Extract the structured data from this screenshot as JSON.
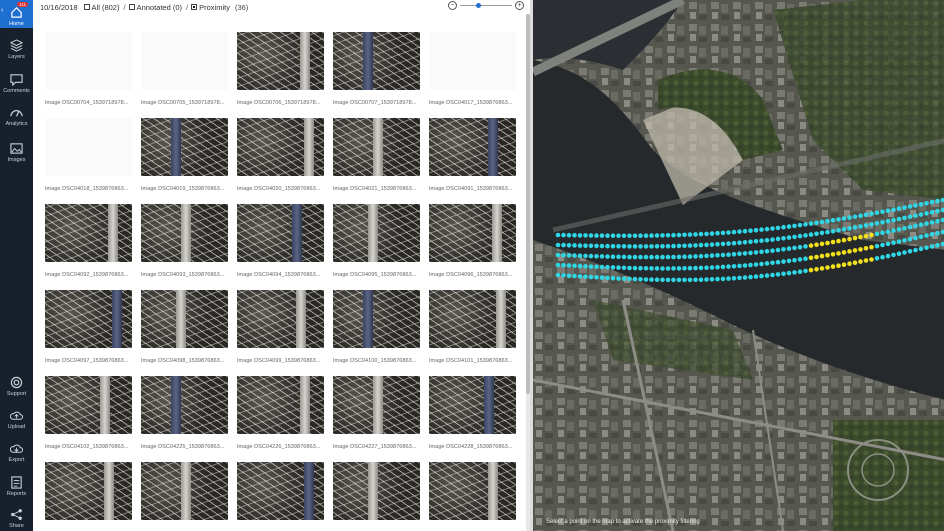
{
  "sidebar": {
    "badge": "111",
    "items": [
      {
        "label": "Home",
        "icon": "home-icon",
        "active": true
      },
      {
        "label": "Layers",
        "icon": "layers-icon"
      },
      {
        "label": "Comments",
        "icon": "comment-icon"
      },
      {
        "label": "Analytics",
        "icon": "gauge-icon"
      },
      {
        "label": "Images",
        "icon": "image-icon"
      },
      {
        "label": "Support",
        "icon": "lifebuoy-icon"
      },
      {
        "label": "Upload",
        "icon": "cloud-upload-icon"
      },
      {
        "label": "Export",
        "icon": "cloud-download-icon"
      },
      {
        "label": "Reports",
        "icon": "report-icon"
      },
      {
        "label": "Share",
        "icon": "share-icon"
      }
    ]
  },
  "topbar": {
    "date": "10/16/2018",
    "filters": [
      {
        "label": "All (802)",
        "checked": false
      },
      {
        "label": "Annotated (0)",
        "checked": false
      },
      {
        "label": "Proximity",
        "checked": true
      }
    ],
    "separator": "/",
    "proximity_count": "(36)",
    "zoom_out": "⊖",
    "zoom_in": "⊕",
    "zoom_level": 0.3
  },
  "gallery": {
    "images": [
      {
        "label": "Image DSC00704_1539718978...",
        "kind": "blank"
      },
      {
        "label": "Image DSC00705_1539718978...",
        "kind": "blank"
      },
      {
        "label": "Image DSC00706_1539718978...",
        "kind": "photo"
      },
      {
        "label": "Image DSC00707_1539718978...",
        "kind": "photo"
      },
      {
        "label": "Image DSC04017_1539876863...",
        "kind": "blank"
      },
      {
        "label": "Image DSC04018_1539876863...",
        "kind": "blank"
      },
      {
        "label": "Image DSC04019_1539876863...",
        "kind": "photo"
      },
      {
        "label": "Image DSC04020_1539876863...",
        "kind": "photo"
      },
      {
        "label": "Image DSC04021_1539876863...",
        "kind": "photo"
      },
      {
        "label": "Image DSC04091_1539876863...",
        "kind": "photo"
      },
      {
        "label": "Image DSC04092_1539876863...",
        "kind": "photo"
      },
      {
        "label": "Image DSC04093_1539876863...",
        "kind": "photo"
      },
      {
        "label": "Image DSC04094_1539876863...",
        "kind": "photo"
      },
      {
        "label": "Image DSC04095_1539876863...",
        "kind": "photo"
      },
      {
        "label": "Image DSC04096_1539876863...",
        "kind": "photo"
      },
      {
        "label": "Image DSC04097_1539876863...",
        "kind": "photo"
      },
      {
        "label": "Image DSC04098_1539876863...",
        "kind": "photo"
      },
      {
        "label": "Image DSC04099_1539876863...",
        "kind": "photo"
      },
      {
        "label": "Image DSC04100_1539876863...",
        "kind": "photo"
      },
      {
        "label": "Image DSC04101_1539876863...",
        "kind": "photo"
      },
      {
        "label": "Image DSC04102_1539876863...",
        "kind": "photo"
      },
      {
        "label": "Image DSC04225_1539876863...",
        "kind": "photo"
      },
      {
        "label": "Image DSC04226_1539876863...",
        "kind": "photo"
      },
      {
        "label": "Image DSC04227_1539876863...",
        "kind": "photo"
      },
      {
        "label": "Image DSC04228_1539876863...",
        "kind": "photo"
      },
      {
        "label": "",
        "kind": "photo"
      },
      {
        "label": "",
        "kind": "photo"
      },
      {
        "label": "",
        "kind": "photo"
      },
      {
        "label": "",
        "kind": "photo"
      },
      {
        "label": "",
        "kind": "photo"
      }
    ]
  },
  "map": {
    "hint": "Select a point on the map to activate the proximity filtering",
    "point_colors": {
      "default": "#2fd6e6",
      "selected": "#f2e11a"
    }
  }
}
